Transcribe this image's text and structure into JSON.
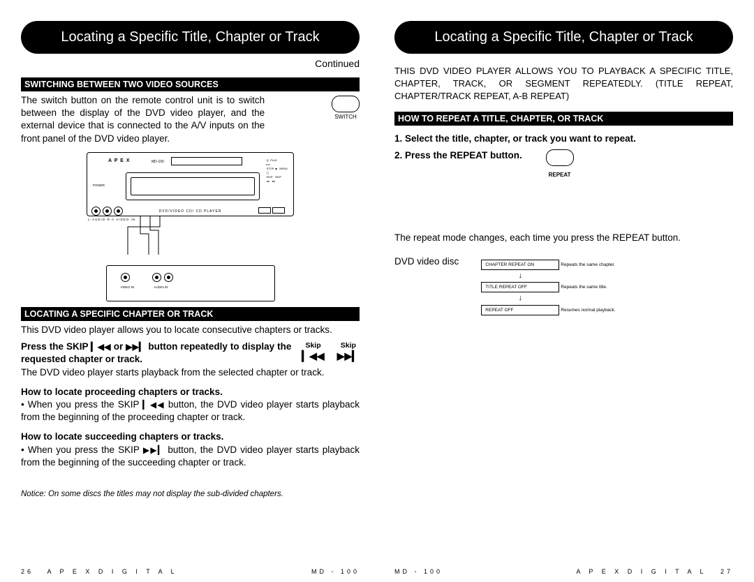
{
  "left": {
    "title": "Locating a Specific Title, Chapter or Track",
    "continued": "Continued",
    "section1": {
      "heading": "SWITCHING BETWEEN TWO VIDEO SOURCES",
      "body": "The switch button on the remote control unit is to switch between the display of the DVD video player, and the external device that is connected to the A/V inputs on the front panel of the DVD video player.",
      "switch_label": "SWITCH"
    },
    "player": {
      "brand": "A P E X",
      "model": "MD-100",
      "label": "DVD/VIDEO CD/ CD PLAYER",
      "jacks_label": "L-AUDIO R-A  VIDEO IN",
      "power": "POWER",
      "controls": "◎  PLAY\n▸ ▸\nSTOP  ■   MENU\n▢\nSKIP   SKIP\n◂◂    ▸▸"
    },
    "ext": {
      "lbl1": "VIDEO\nIN",
      "lbl2": "AUDIO IN"
    },
    "section2": {
      "heading": "LOCATING A SPECIFIC CHAPTER OR TRACK",
      "body": "This DVD video player allows you to locate consecutive chapters or tracks.",
      "instruction_a": "Press the SKIP ",
      "instruction_b": " or ",
      "instruction_c": "  button repeatedly to display the requested chapter or track.",
      "skip_label": "Skip",
      "result": "The DVD video player starts playback from the selected chapter or track.",
      "sub1_heading": "How to locate proceeding chapters or tracks.",
      "sub1_body_a": "• When you press the SKIP ",
      "sub1_body_b": " button, the DVD video player starts playback from the  beginning of the proceeding chapter or track.",
      "sub2_heading": "How to locate succeeding chapters or tracks.",
      "sub2_body_a": "• When you press the SKIP ",
      "sub2_body_b": " button, the DVD video player starts playback from the beginning of the succeeding chapter or track."
    },
    "notice": "Notice:  On some discs the titles may not display the sub-divided chapters.",
    "footer_page": "26",
    "footer_brand": "A  P  E  X     D  I  G  I  T  A  L",
    "footer_model": "MD - 100"
  },
  "right": {
    "title": "Locating a Specific Title, Chapter or Track",
    "intro": "THIS DVD VIDEO PLAYER ALLOWS YOU TO PLAYBACK A SPECIFIC TITLE, CHAPTER, TRACK, OR SEGMENT REPEATEDLY. (TITLE REPEAT, CHAPTER/TRACK REPEAT, A-B REPEAT)",
    "section1": {
      "heading": "HOW TO REPEAT A TITLE, CHAPTER, OR TRACK",
      "step1": "1. Select the title, chapter, or track you want to repeat.",
      "step2": "2. Press the REPEAT button.",
      "repeat_label": "REPEAT",
      "result": "The repeat mode changes, each time you press the REPEAT button.",
      "disc_label": "DVD video disc",
      "states": [
        {
          "box": "CHAPTER REPEAT ON",
          "desc": "Repeats the same chapter."
        },
        {
          "box": "TITLE REPEAT OFF",
          "desc": "Repeats the same title."
        },
        {
          "box": "REPEAT OFF",
          "desc": "Resumes normal playback."
        }
      ]
    },
    "footer_page": "27",
    "footer_brand": "A  P  E  X     D  I  G  I  T  A  L",
    "footer_model": "MD - 100"
  },
  "icons": {
    "skip_back": "▎◀◀",
    "skip_fwd": "▶▶▎"
  }
}
